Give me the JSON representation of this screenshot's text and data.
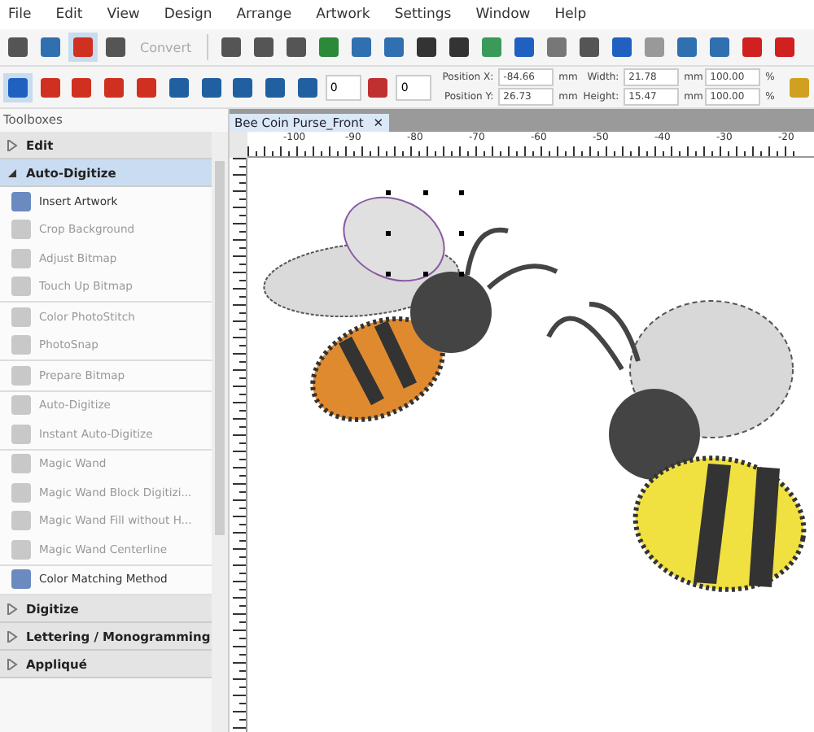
{
  "menu": [
    "File",
    "Edit",
    "View",
    "Design",
    "Arrange",
    "Artwork",
    "Settings",
    "Window",
    "Help"
  ],
  "toolbar": {
    "convert": {
      "label": "Convert",
      "disabled": true
    },
    "angle_1": "0",
    "angle_2": "0",
    "position_x": {
      "label": "Position X:",
      "value": "-84.66",
      "unit": "mm"
    },
    "position_y": {
      "label": "Position Y:",
      "value": "26.73",
      "unit": "mm"
    },
    "width": {
      "label": "Width:",
      "value": "21.78",
      "unit": "mm",
      "scale": "100.00",
      "scale_unit": "%"
    },
    "height": {
      "label": "Height:",
      "value": "15.47",
      "unit": "mm",
      "scale": "100.00",
      "scale_unit": "%"
    }
  },
  "toolboxes": {
    "title": "Toolboxes",
    "sections_before": [
      {
        "label": "Edit",
        "expanded": false,
        "selected": false
      },
      {
        "label": "Auto-Digitize",
        "expanded": true,
        "selected": true
      }
    ],
    "groups": [
      [
        {
          "label": "Insert Artwork",
          "disabled": false
        },
        {
          "label": "Crop Background",
          "disabled": true
        },
        {
          "label": "Adjust Bitmap",
          "disabled": true
        },
        {
          "label": "Touch Up Bitmap",
          "disabled": true
        }
      ],
      [
        {
          "label": "Color PhotoStitch",
          "disabled": true
        },
        {
          "label": "PhotoSnap",
          "disabled": true
        }
      ],
      [
        {
          "label": "Prepare Bitmap",
          "disabled": true
        }
      ],
      [
        {
          "label": "Auto-Digitize",
          "disabled": true
        },
        {
          "label": "Instant Auto-Digitize",
          "disabled": true
        }
      ],
      [
        {
          "label": "Magic Wand",
          "disabled": true
        },
        {
          "label": "Magic Wand Block Digitizi...",
          "disabled": true
        },
        {
          "label": "Magic Wand Fill without H...",
          "disabled": true
        },
        {
          "label": "Magic Wand Centerline",
          "disabled": true
        }
      ],
      [
        {
          "label": "Color Matching Method",
          "disabled": false
        }
      ]
    ],
    "sections_after": [
      {
        "label": "Digitize",
        "expanded": false,
        "selected": false
      },
      {
        "label": "Lettering / Monogramming",
        "expanded": false,
        "selected": false
      },
      {
        "label": "Appliqué",
        "expanded": false,
        "selected": false
      }
    ]
  },
  "document_tab": {
    "label": "Bee Coin Purse_Front",
    "close": "✕"
  },
  "ruler": {
    "labels": [
      "-100",
      "-90",
      "-80",
      "-70",
      "-60",
      "-50",
      "-40",
      "-30",
      "-20"
    ]
  }
}
